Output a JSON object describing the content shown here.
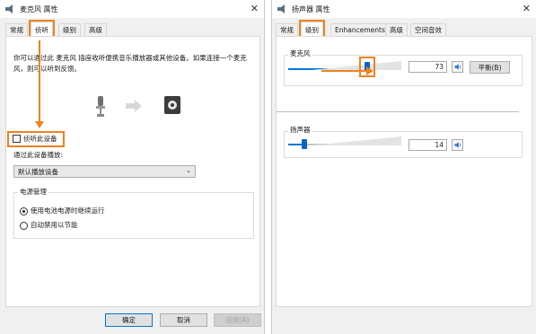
{
  "left_window": {
    "title": "麦克风 属性",
    "tabs": [
      "常规",
      "侦听",
      "级别",
      "高级"
    ],
    "active_tab": "侦听",
    "description": "你可以通过此 麦克风 插座收听便携音乐播放器或其他设备。如果连接一个麦克风，则可以听到反馈。",
    "listen_checkbox_label": "侦听此设备",
    "listen_checkbox_checked": false,
    "playback_label": "通过此设备播放:",
    "playback_device": "默认播放设备",
    "power_group_label": "电源管理",
    "radio_options": [
      "使用电池电源时继续运行",
      "自动禁用以节能"
    ],
    "radio_selected": 0,
    "buttons": {
      "ok": "确定",
      "cancel": "取消",
      "apply": "应用(A)"
    },
    "highlight_color": "#f0821e",
    "icons": [
      "microphone-icon",
      "arrow-right-icon",
      "speaker-icon"
    ]
  },
  "right_window": {
    "title": "扬声器 属性",
    "tabs": [
      "常规",
      "级别",
      "Enhancements",
      "高级",
      "空间音效"
    ],
    "active_tab": "级别",
    "microphone": {
      "label": "麦克风",
      "level": 73,
      "level_fraction": 0.73,
      "balance_button": "平衡(B)"
    },
    "speaker": {
      "label": "扬声器",
      "level": 14,
      "level_fraction": 0.14
    },
    "accent_color": "#0078d7"
  }
}
